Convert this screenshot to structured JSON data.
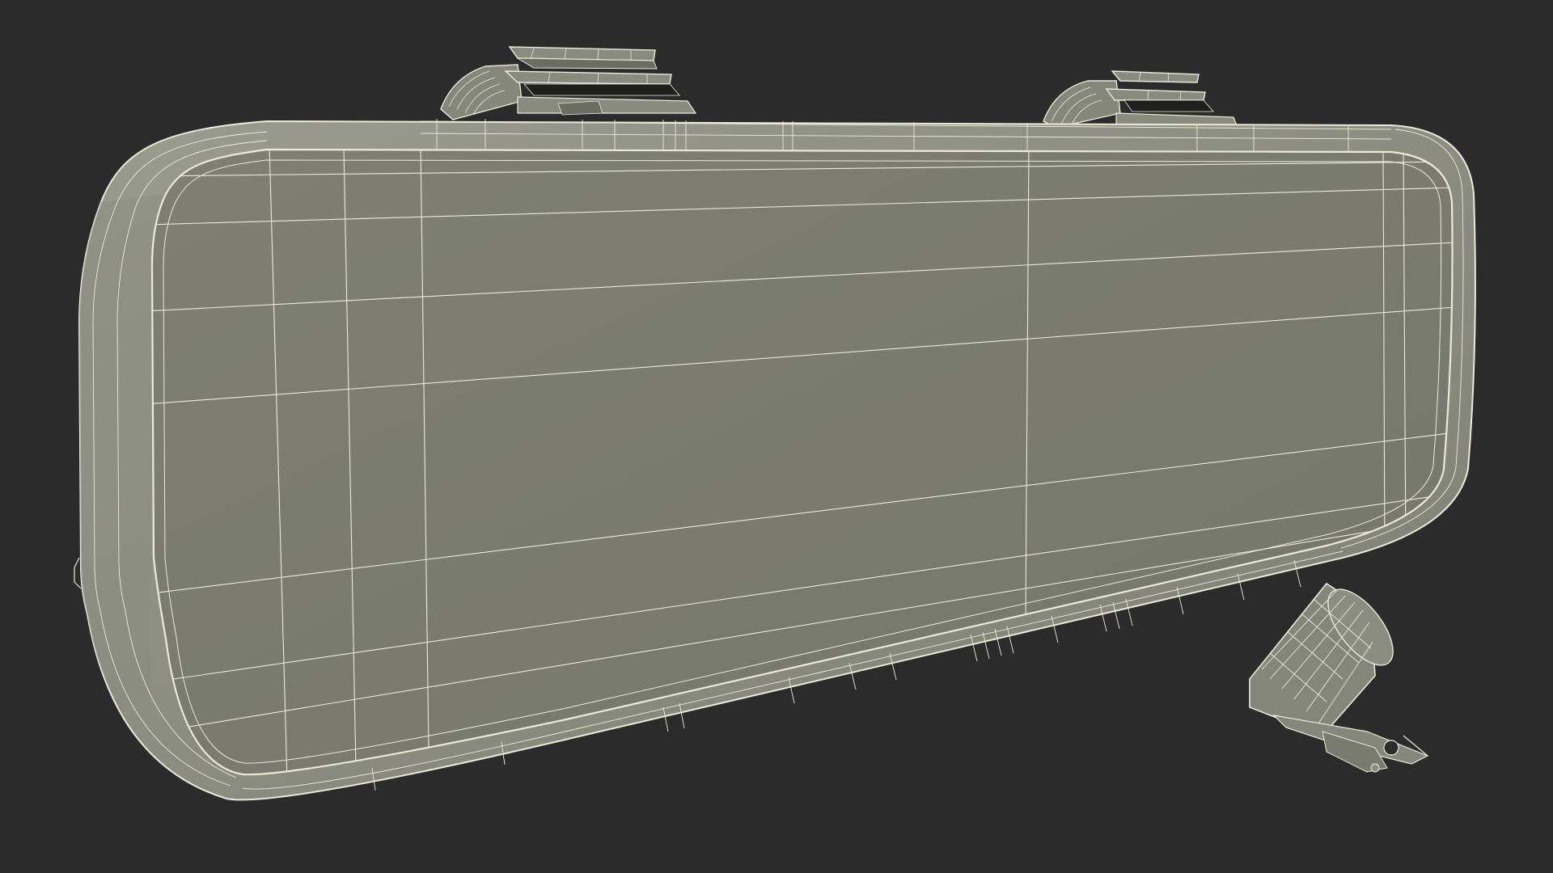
{
  "render": {
    "background_color": "#2b2b2b",
    "surface_color": "#7c7d70",
    "rim_color": "#8d8e82",
    "shadow_color": "#5d5e55",
    "wire_color": "#ecead6",
    "dark_detail_color": "#1e1e1c"
  },
  "objects": [
    {
      "name": "rearview-mirror-body",
      "kind": "3d-model"
    },
    {
      "name": "mirror-mount-clip-left",
      "kind": "3d-model"
    },
    {
      "name": "mirror-mount-clip-right",
      "kind": "3d-model"
    },
    {
      "name": "rear-camera-module",
      "kind": "3d-model"
    }
  ]
}
